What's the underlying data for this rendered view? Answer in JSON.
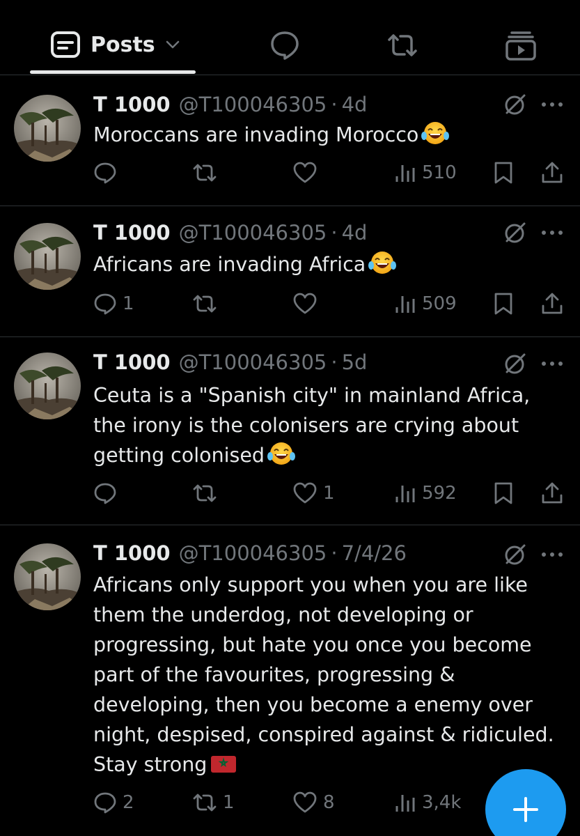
{
  "tabs": {
    "posts_label": "Posts",
    "icons": [
      "posts-icon",
      "chevron-down-icon",
      "replies-icon",
      "reposts-icon",
      "media-icon"
    ]
  },
  "posts": [
    {
      "name": "T 1000",
      "handle": "@T100046305",
      "separator": "·",
      "time": "4d",
      "text": "Moroccans are invading Morocco",
      "emoji": "laughing-tears-emoji",
      "replies": "",
      "reposts": "",
      "likes": "",
      "views": "510"
    },
    {
      "name": "T 1000",
      "handle": "@T100046305",
      "separator": "·",
      "time": "4d",
      "text": "Africans are invading Africa",
      "emoji": "laughing-tears-emoji",
      "replies": "1",
      "reposts": "",
      "likes": "",
      "views": "509"
    },
    {
      "name": "T 1000",
      "handle": "@T100046305",
      "separator": "·",
      "time": "5d",
      "text": "Ceuta is a \"Spanish city\" in mainland Africa,\nthe irony is the colonisers are crying about\ngetting colonised",
      "emoji": "laughing-tears-emoji",
      "replies": "",
      "reposts": "",
      "likes": "1",
      "views": "592"
    },
    {
      "name": "T 1000",
      "handle": "@T100046305",
      "separator": "·",
      "time": "7/4/26",
      "text": "Africans only support you when you are like\nthem the underdog, not developing or\nprogressing, but hate you once you become\npart of the favourites, progressing &\ndeveloping, then you become a enemy over\nnight, despised, conspired against & ridiculed.\nStay strong",
      "emoji": "morocco-flag-emoji",
      "replies": "2",
      "reposts": "1",
      "likes": "8",
      "views": "3,4k"
    }
  ],
  "fab": {
    "icon": "plus-icon"
  },
  "colors": {
    "background": "#000000",
    "text": "#e7e9ea",
    "muted": "#71767b",
    "accent": "#1d9bf0",
    "divider": "#2f3336"
  }
}
